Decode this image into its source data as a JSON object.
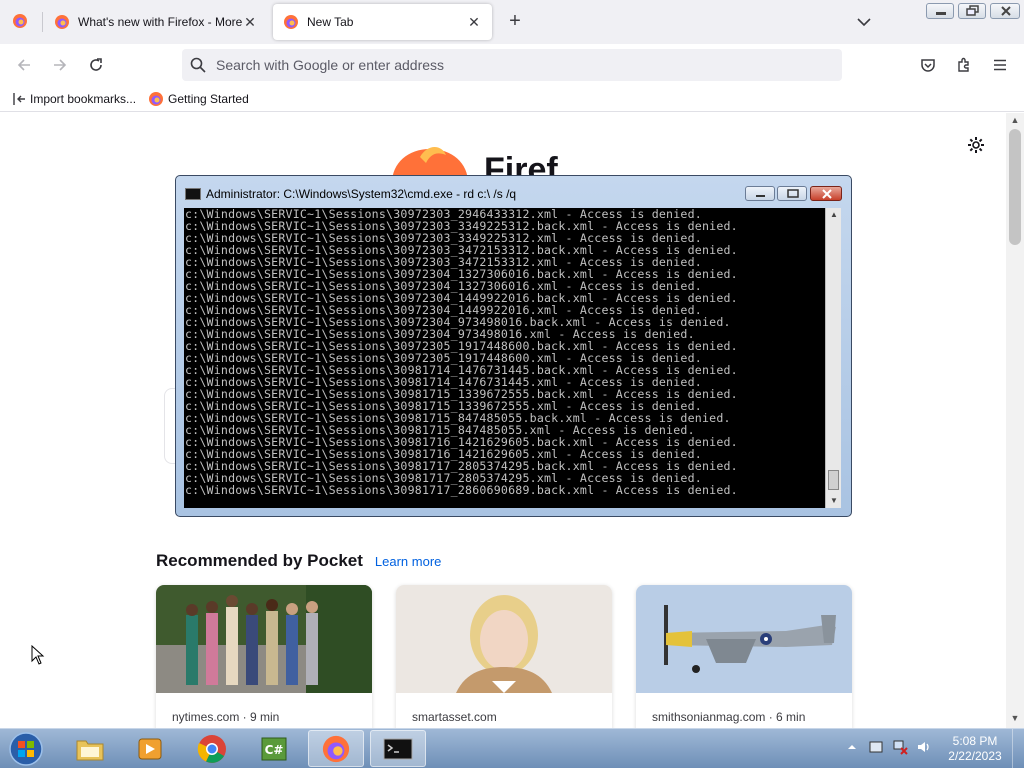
{
  "browser": {
    "tabs": [
      {
        "title": "What's new with Firefox - More",
        "active": false
      },
      {
        "title": "New Tab",
        "active": true
      }
    ],
    "new_tab_symbol": "+",
    "close_symbol": "✕",
    "urlbar": {
      "placeholder": "Search with Google or enter address"
    },
    "bookmarks": [
      {
        "label": "Import bookmarks...",
        "icon": "import-icon"
      },
      {
        "label": "Getting Started",
        "icon": "firefox-icon"
      }
    ]
  },
  "newtab": {
    "pocket_heading": "Recommended by Pocket",
    "pocket_link": "Learn more",
    "cards": [
      {
        "source": "nytimes.com · 9 min"
      },
      {
        "source": "smartasset.com"
      },
      {
        "source": "smithsonianmag.com · 6 min"
      }
    ]
  },
  "cmd": {
    "title": "Administrator: C:\\Windows\\System32\\cmd.exe - rd  c:\\ /s /q",
    "lines": [
      "c:\\Windows\\SERVIC~1\\Sessions\\30972303_2946433312.xml - Access is denied.",
      "c:\\Windows\\SERVIC~1\\Sessions\\30972303_3349225312.back.xml - Access is denied.",
      "c:\\Windows\\SERVIC~1\\Sessions\\30972303_3349225312.xml - Access is denied.",
      "c:\\Windows\\SERVIC~1\\Sessions\\30972303_3472153312.back.xml - Access is denied.",
      "c:\\Windows\\SERVIC~1\\Sessions\\30972303_3472153312.xml - Access is denied.",
      "c:\\Windows\\SERVIC~1\\Sessions\\30972304_1327306016.back.xml - Access is denied.",
      "c:\\Windows\\SERVIC~1\\Sessions\\30972304_1327306016.xml - Access is denied.",
      "c:\\Windows\\SERVIC~1\\Sessions\\30972304_1449922016.back.xml - Access is denied.",
      "c:\\Windows\\SERVIC~1\\Sessions\\30972304_1449922016.xml - Access is denied.",
      "c:\\Windows\\SERVIC~1\\Sessions\\30972304_973498016.back.xml - Access is denied.",
      "c:\\Windows\\SERVIC~1\\Sessions\\30972304_973498016.xml - Access is denied.",
      "c:\\Windows\\SERVIC~1\\Sessions\\30972305_1917448600.back.xml - Access is denied.",
      "c:\\Windows\\SERVIC~1\\Sessions\\30972305_1917448600.xml - Access is denied.",
      "c:\\Windows\\SERVIC~1\\Sessions\\30981714_1476731445.back.xml - Access is denied.",
      "c:\\Windows\\SERVIC~1\\Sessions\\30981714_1476731445.xml - Access is denied.",
      "c:\\Windows\\SERVIC~1\\Sessions\\30981715_1339672555.back.xml - Access is denied.",
      "c:\\Windows\\SERVIC~1\\Sessions\\30981715_1339672555.xml - Access is denied.",
      "c:\\Windows\\SERVIC~1\\Sessions\\30981715_847485055.back.xml - Access is denied.",
      "c:\\Windows\\SERVIC~1\\Sessions\\30981715_847485055.xml - Access is denied.",
      "c:\\Windows\\SERVIC~1\\Sessions\\30981716_1421629605.back.xml - Access is denied.",
      "c:\\Windows\\SERVIC~1\\Sessions\\30981716_1421629605.xml - Access is denied.",
      "c:\\Windows\\SERVIC~1\\Sessions\\30981717_2805374295.back.xml - Access is denied.",
      "c:\\Windows\\SERVIC~1\\Sessions\\30981717_2805374295.xml - Access is denied.",
      "c:\\Windows\\SERVIC~1\\Sessions\\30981717_2860690689.back.xml - Access is denied."
    ]
  },
  "taskbar": {
    "items": [
      {
        "name": "explorer",
        "icon": "folder-icon"
      },
      {
        "name": "media-player",
        "icon": "media-player-icon"
      },
      {
        "name": "chrome",
        "icon": "chrome-icon"
      },
      {
        "name": "csharp",
        "icon": "csharp-icon"
      },
      {
        "name": "firefox",
        "icon": "firefox-icon",
        "active": true
      },
      {
        "name": "cmd",
        "icon": "cmd-icon",
        "active": true
      }
    ],
    "clock": {
      "time": "5:08 PM",
      "date": "2/22/2023"
    }
  },
  "colors": {
    "accent": "#0061e0",
    "tabstrip": "#f0f0f4",
    "taskbar": "#7f9dc4"
  }
}
